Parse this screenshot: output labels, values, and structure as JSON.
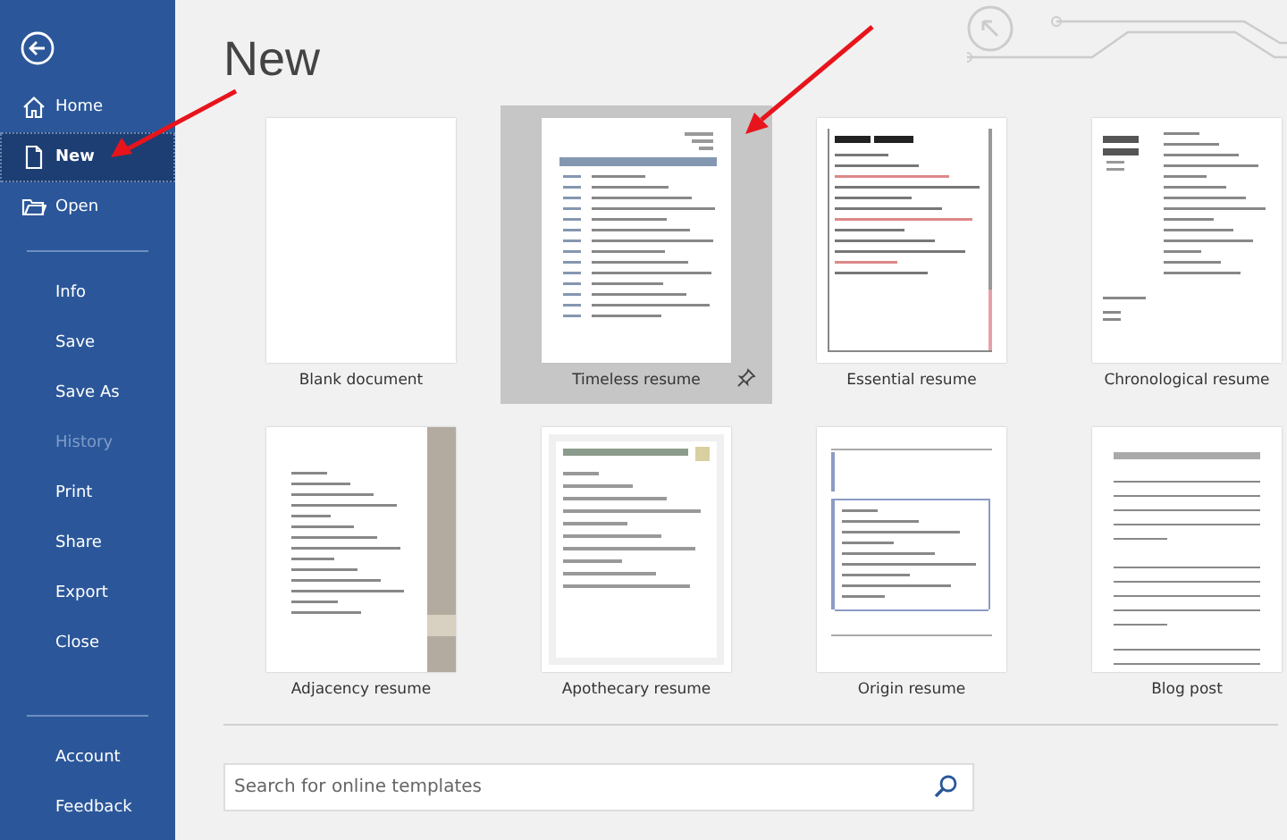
{
  "sidebar": {
    "sections": [
      {
        "items": [
          {
            "label": "Home",
            "selected": false,
            "disabled": false
          },
          {
            "label": "New",
            "selected": true,
            "disabled": false
          },
          {
            "label": "Open",
            "selected": false,
            "disabled": false
          }
        ]
      },
      {
        "items": [
          {
            "label": "Info",
            "selected": false,
            "disabled": false
          },
          {
            "label": "Save",
            "selected": false,
            "disabled": false
          },
          {
            "label": "Save As",
            "selected": false,
            "disabled": false
          },
          {
            "label": "History",
            "selected": false,
            "disabled": true
          },
          {
            "label": "Print",
            "selected": false,
            "disabled": false
          },
          {
            "label": "Share",
            "selected": false,
            "disabled": false
          },
          {
            "label": "Export",
            "selected": false,
            "disabled": false
          },
          {
            "label": "Close",
            "selected": false,
            "disabled": false
          }
        ]
      },
      {
        "items": [
          {
            "label": "Account",
            "selected": false,
            "disabled": false
          },
          {
            "label": "Feedback",
            "selected": false,
            "disabled": false
          }
        ]
      }
    ]
  },
  "page_title": "New",
  "templates": [
    {
      "name": "Blank document",
      "kind": "blank",
      "selected": false
    },
    {
      "name": "Timeless resume",
      "kind": "timeless",
      "selected": true
    },
    {
      "name": "Essential resume",
      "kind": "essential",
      "selected": false
    },
    {
      "name": "Chronological resume",
      "kind": "chronological",
      "selected": false
    },
    {
      "name": "Adjacency resume",
      "kind": "adjacency",
      "selected": false
    },
    {
      "name": "Apothecary resume",
      "kind": "apothecary",
      "selected": false
    },
    {
      "name": "Origin resume",
      "kind": "origin",
      "selected": false
    },
    {
      "name": "Blog post",
      "kind": "blog",
      "selected": false
    }
  ],
  "search": {
    "placeholder": "Search for online templates"
  }
}
